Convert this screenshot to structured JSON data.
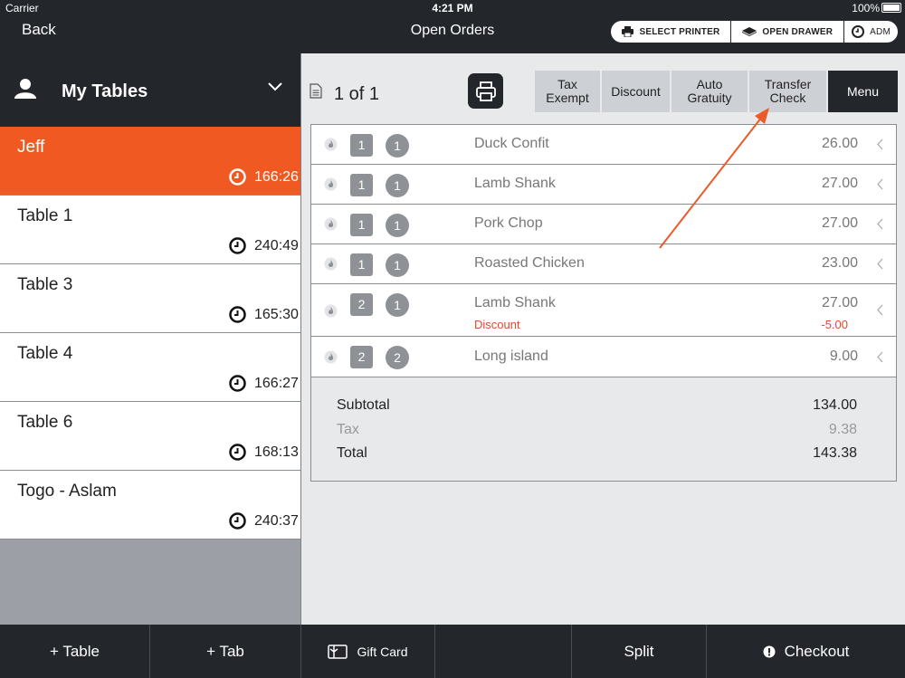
{
  "status_bar": {
    "carrier": "Carrier",
    "time": "4:21 PM",
    "battery": "100%"
  },
  "header": {
    "back": "Back",
    "title": "Open Orders",
    "select_printer": "SELECT PRINTER",
    "open_drawer": "OPEN DRAWER",
    "user": "ADM"
  },
  "sidebar": {
    "title": "My Tables",
    "tables": [
      {
        "name": "Jeff",
        "time": "166:26"
      },
      {
        "name": "Table 1",
        "time": "240:49"
      },
      {
        "name": "Table 3",
        "time": "165:30"
      },
      {
        "name": "Table 4",
        "time": "166:27"
      },
      {
        "name": "Table 6",
        "time": "168:13"
      },
      {
        "name": "Togo - Aslam",
        "time": "240:37"
      }
    ]
  },
  "check": {
    "pager": "1 of 1",
    "actions": {
      "tax_exempt_1": "Tax",
      "tax_exempt_2": "Exempt",
      "discount": "Discount",
      "auto_gratuity_1": "Auto",
      "auto_gratuity_2": "Gratuity",
      "transfer_check_1": "Transfer",
      "transfer_check_2": "Check",
      "menu": "Menu"
    },
    "items": [
      {
        "seat": "1",
        "qty": "1",
        "name": "Duck Confit",
        "price": "26.00"
      },
      {
        "seat": "1",
        "qty": "1",
        "name": "Lamb Shank",
        "price": "27.00"
      },
      {
        "seat": "1",
        "qty": "1",
        "name": "Pork Chop",
        "price": "27.00"
      },
      {
        "seat": "1",
        "qty": "1",
        "name": "Roasted Chicken",
        "price": "23.00"
      },
      {
        "seat": "2",
        "qty": "1",
        "name": "Lamb Shank",
        "price": "27.00",
        "modifier": "Discount",
        "modifier_price": "-5.00"
      },
      {
        "seat": "2",
        "qty": "2",
        "name": "Long island",
        "price": "9.00"
      }
    ],
    "totals": {
      "subtotal_label": "Subtotal",
      "subtotal": "134.00",
      "tax_label": "Tax",
      "tax": "9.38",
      "total_label": "Total",
      "total": "143.38"
    }
  },
  "footer": {
    "add_table": "+ Table",
    "add_tab": "+ Tab",
    "gift_card": "Gift Card",
    "split": "Split",
    "checkout": "Checkout"
  },
  "colors": {
    "accent": "#f05a22",
    "dark": "#23262b",
    "discount": "#e24a2a"
  }
}
